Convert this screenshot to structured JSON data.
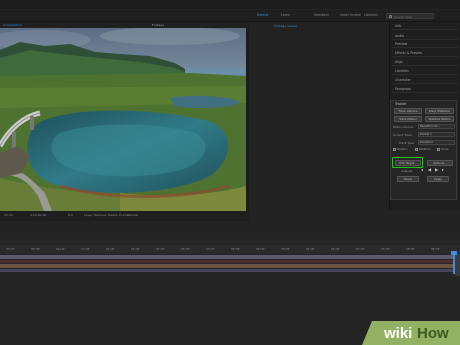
{
  "workspaces": [
    "Default",
    "Learn",
    "Standard",
    "Small Screen",
    "Libraries"
  ],
  "search": {
    "placeholder": "Search Help"
  },
  "composition": {
    "viewer_tab": "Composition",
    "comp_label": "Footage",
    "layer_text": "Footage (none)"
  },
  "right_panel": {
    "items": [
      "Info",
      "Audio",
      "Preview",
      "Effects & Presets",
      "Align",
      "Libraries",
      "Character",
      "Paragraph"
    ]
  },
  "tracker": {
    "title": "Tracker",
    "buttons": [
      "Track Camera",
      "Warp Stabilizer",
      "Track Motion",
      "Stabilize Motion"
    ],
    "motion_source_label": "Motion Source:",
    "motion_source_value": "Beautiful Lofo...",
    "current_track_label": "Current Track:",
    "current_track_value": "Tracker 1",
    "track_type_label": "Track Type:",
    "track_type_value": "Transform",
    "position_label": "Position",
    "rotation_label": "Rotation",
    "scale_label": "Scale",
    "edit_target": "Edit Target...",
    "options": "Options...",
    "analyze_label": "Analyze:",
    "reset": "Reset",
    "apply": "Apply"
  },
  "viewer_footer": {
    "zoom": "53.4%",
    "timecode": "0;00;00;00",
    "full": "Full",
    "layer_label": "Layer: Remove Tracker Points",
    "render": "Render"
  },
  "timeline": {
    "ticks": [
      "00:15f",
      "00:30f",
      "01:15f",
      "01:30f",
      "02:15f",
      "02:30f",
      "03:15f",
      "03:30f",
      "04:15f",
      "04:30f",
      "05:15f",
      "05:30f",
      "06:15f",
      "06:30f",
      "07:15f",
      "07:30f",
      "08:15f",
      "08:30f"
    ]
  },
  "watermark": {
    "wiki": "wiki",
    "how": "How"
  },
  "colors": {
    "accent": "#3b8fdc",
    "highlight": "#23c41c"
  }
}
